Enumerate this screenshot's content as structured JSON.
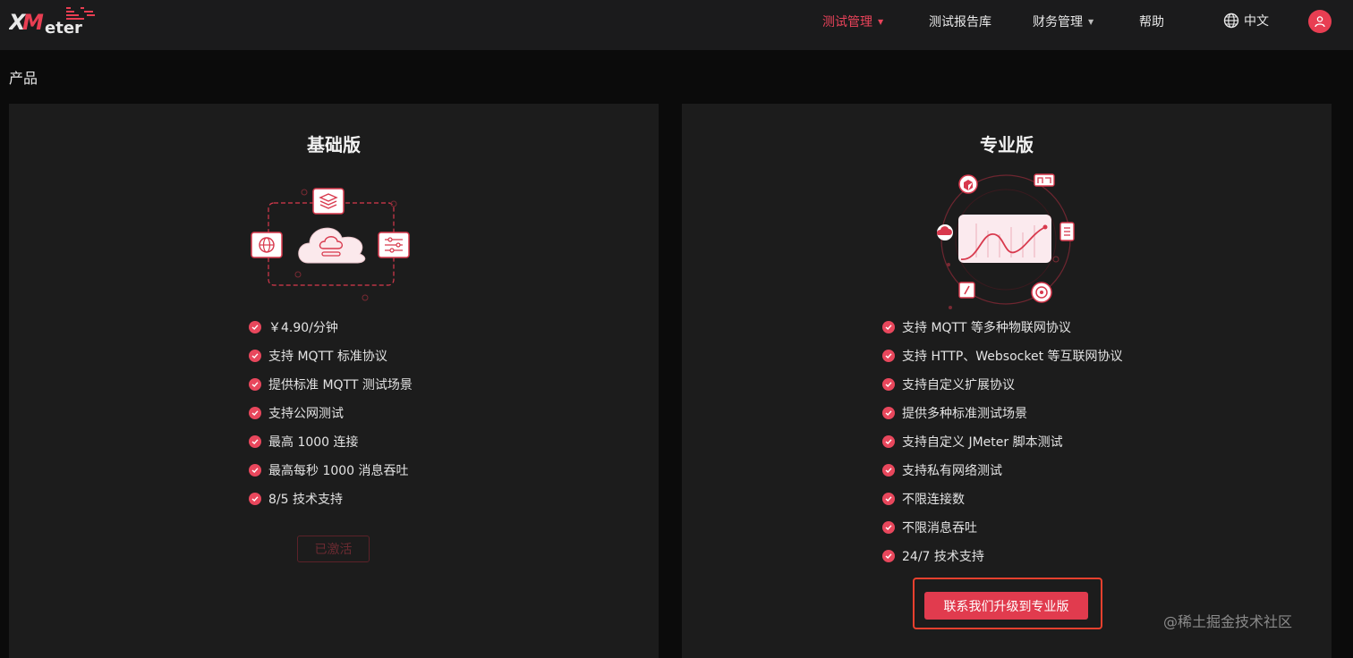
{
  "header": {
    "logo_text": "XMeter",
    "nav": [
      {
        "label": "测试管理",
        "dropdown": true,
        "active": true
      },
      {
        "label": "测试报告库",
        "dropdown": false,
        "active": false
      },
      {
        "label": "财务管理",
        "dropdown": true,
        "active": false
      },
      {
        "label": "帮助",
        "dropdown": false,
        "active": false
      }
    ],
    "language": "中文",
    "language_icon": "globe-icon",
    "avatar_icon": "user-icon"
  },
  "page": {
    "title": "产品"
  },
  "plans": {
    "basic": {
      "title": "基础版",
      "features": [
        "￥4.90/分钟",
        "支持 MQTT 标准协议",
        "提供标准 MQTT 测试场景",
        "支持公网测试",
        "最高 1000 连接",
        "最高每秒 1000 消息吞吐",
        "8/5 技术支持"
      ],
      "button": "已激活",
      "button_state": "disabled"
    },
    "pro": {
      "title": "专业版",
      "features": [
        "支持 MQTT 等多种物联网协议",
        "支持 HTTP、Websocket 等互联网协议",
        "支持自定义扩展协议",
        "提供多种标准测试场景",
        "支持自定义 JMeter 脚本测试",
        "支持私有网络测试",
        "不限连接数",
        "不限消息吞吐",
        "24/7 技术支持"
      ],
      "button": "联系我们升级到专业版"
    }
  },
  "watermark": "@稀土掘金技术社区",
  "colors": {
    "accent": "#e13b4e",
    "active_nav": "#e9435a",
    "highlight_border": "#e8402e",
    "background": "#0b0b0b",
    "card": "#1c1c1c",
    "header": "#1b1b1c"
  }
}
